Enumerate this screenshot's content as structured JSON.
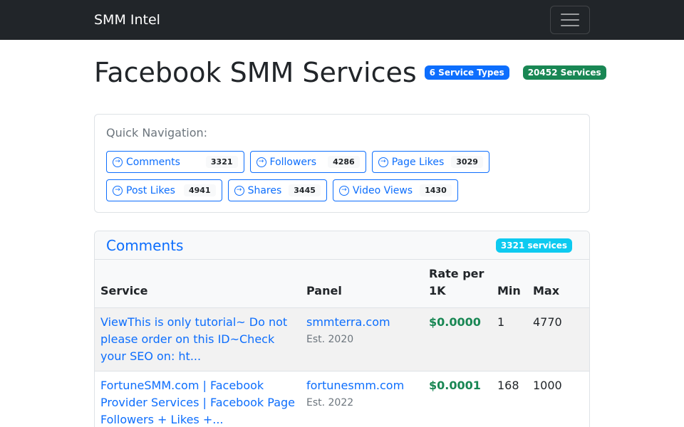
{
  "nav": {
    "brand": "SMM Intel"
  },
  "page": {
    "title": "Facebook SMM Services",
    "badge_types": "6 Service Types",
    "badge_total": "20452 Services"
  },
  "quick_nav": {
    "label": "Quick Navigation:",
    "items": [
      {
        "label": "Comments",
        "count": "3321"
      },
      {
        "label": "Followers",
        "count": "4286"
      },
      {
        "label": "Page Likes",
        "count": "3029"
      },
      {
        "label": "Post Likes",
        "count": "4941"
      },
      {
        "label": "Shares",
        "count": "3445"
      },
      {
        "label": "Video Views",
        "count": "1430"
      }
    ]
  },
  "section": {
    "title": "Comments",
    "badge": "3321 services",
    "columns": [
      "Service",
      "Panel",
      "Rate per 1K",
      "Min",
      "Max"
    ],
    "rows": [
      {
        "service": "ViewThis is only tutorial~ Do not please order on this ID~Check your SEO on: ht...",
        "panel": "smmterra.com",
        "est": "Est. 2020",
        "rate": "$0.0000",
        "min": "1",
        "max": "4770"
      },
      {
        "service": "FortuneSMM.com | Facebook Provider Services | Facebook Page Followers + Likes +...",
        "panel": "fortunesmm.com",
        "est": "Est. 2022",
        "rate": "$0.0001",
        "min": "168",
        "max": "1000"
      }
    ]
  },
  "colors": {
    "primary": "#0d6efd",
    "success": "#198754",
    "info": "#0dcaf0",
    "navbar": "#212529",
    "count_badges": [
      "#f8f9fa"
    ]
  },
  "icons": {
    "nav_item": "arrow-right-circle-icon",
    "menu": "hamburger-menu-icon"
  }
}
